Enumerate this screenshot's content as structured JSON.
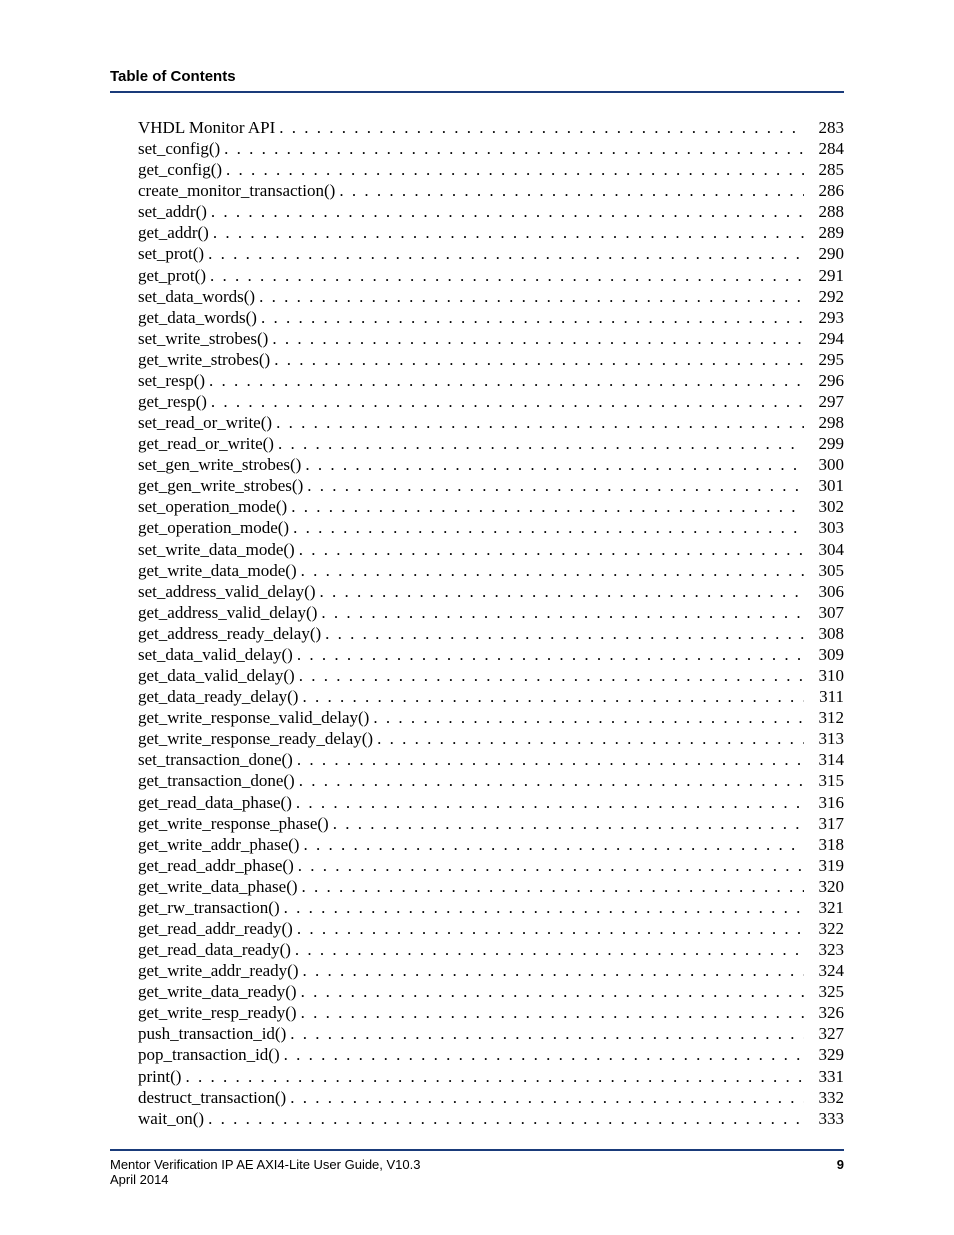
{
  "header": {
    "title": "Table of Contents"
  },
  "toc": {
    "entries": [
      {
        "label": "VHDL Monitor API",
        "page": "283"
      },
      {
        "label": "set_config()",
        "page": "284"
      },
      {
        "label": "get_config()",
        "page": "285"
      },
      {
        "label": "create_monitor_transaction()",
        "page": "286"
      },
      {
        "label": "set_addr()",
        "page": "288"
      },
      {
        "label": "get_addr()",
        "page": "289"
      },
      {
        "label": "set_prot()",
        "page": "290"
      },
      {
        "label": "get_prot()",
        "page": "291"
      },
      {
        "label": "set_data_words()",
        "page": "292"
      },
      {
        "label": "get_data_words()",
        "page": "293"
      },
      {
        "label": "set_write_strobes()",
        "page": "294"
      },
      {
        "label": "get_write_strobes()",
        "page": "295"
      },
      {
        "label": "set_resp()",
        "page": "296"
      },
      {
        "label": "get_resp()",
        "page": "297"
      },
      {
        "label": "set_read_or_write()",
        "page": "298"
      },
      {
        "label": "get_read_or_write()",
        "page": "299"
      },
      {
        "label": "set_gen_write_strobes()",
        "page": "300"
      },
      {
        "label": "get_gen_write_strobes()",
        "page": "301"
      },
      {
        "label": "set_operation_mode()",
        "page": "302"
      },
      {
        "label": "get_operation_mode()",
        "page": "303"
      },
      {
        "label": "set_write_data_mode()",
        "page": "304"
      },
      {
        "label": "get_write_data_mode()",
        "page": "305"
      },
      {
        "label": "set_address_valid_delay()",
        "page": "306"
      },
      {
        "label": "get_address_valid_delay()",
        "page": "307"
      },
      {
        "label": "get_address_ready_delay()",
        "page": "308"
      },
      {
        "label": "set_data_valid_delay()",
        "page": "309"
      },
      {
        "label": "get_data_valid_delay()",
        "page": "310"
      },
      {
        "label": "get_data_ready_delay()",
        "page": "311"
      },
      {
        "label": "get_write_response_valid_delay()",
        "page": "312"
      },
      {
        "label": "get_write_response_ready_delay()",
        "page": "313"
      },
      {
        "label": "set_transaction_done()",
        "page": "314"
      },
      {
        "label": "get_transaction_done()",
        "page": "315"
      },
      {
        "label": "get_read_data_phase()",
        "page": "316"
      },
      {
        "label": "get_write_response_phase()",
        "page": "317"
      },
      {
        "label": "get_write_addr_phase()",
        "page": "318"
      },
      {
        "label": "get_read_addr_phase()",
        "page": "319"
      },
      {
        "label": "get_write_data_phase()",
        "page": "320"
      },
      {
        "label": "get_rw_transaction()",
        "page": "321"
      },
      {
        "label": "get_read_addr_ready()",
        "page": "322"
      },
      {
        "label": "get_read_data_ready()",
        "page": "323"
      },
      {
        "label": "get_write_addr_ready()",
        "page": "324"
      },
      {
        "label": "get_write_data_ready()",
        "page": "325"
      },
      {
        "label": "get_write_resp_ready()",
        "page": "326"
      },
      {
        "label": "push_transaction_id()",
        "page": "327"
      },
      {
        "label": "pop_transaction_id()",
        "page": "329"
      },
      {
        "label": "print()",
        "page": "331"
      },
      {
        "label": "destruct_transaction()",
        "page": "332"
      },
      {
        "label": "wait_on()",
        "page": "333"
      }
    ]
  },
  "footer": {
    "left_line1": "Mentor Verification IP AE AXI4-Lite User Guide, V10.3",
    "left_line2": "April 2014",
    "page_number": "9"
  }
}
